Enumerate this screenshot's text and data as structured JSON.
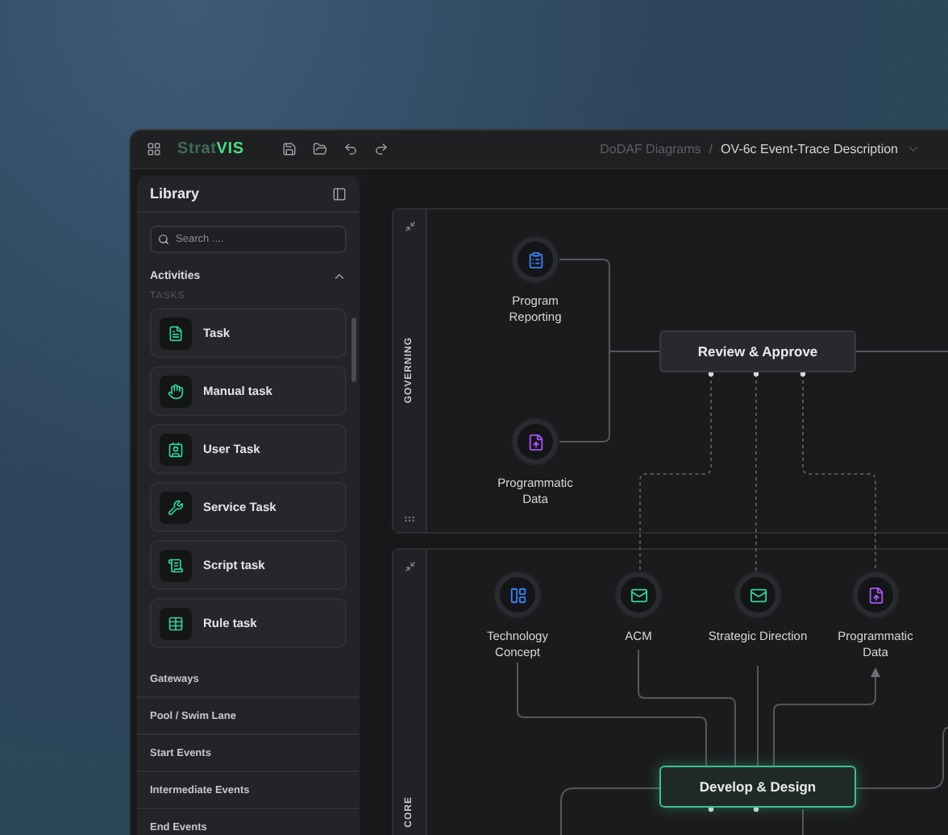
{
  "app": {
    "logo": "Strat**VIS**",
    "breadcrumb": [
      {
        "label": "DoDAF Diagrams",
        "current": false
      },
      {
        "label": "OV-6c Event-Trace Description",
        "current": true
      }
    ],
    "separator": "/"
  },
  "sidebar": {
    "title": "Library",
    "search": {
      "placeholder": "Search ...."
    },
    "section": {
      "title": "Activities",
      "expanded": true,
      "group": "TASKS",
      "items": [
        {
          "label": "Task",
          "kind": "task"
        },
        {
          "label": "Manual task",
          "kind": "manual"
        },
        {
          "label": "User Task",
          "kind": "user"
        },
        {
          "label": "Service Task",
          "kind": "service"
        },
        {
          "label": "Script task",
          "kind": "script"
        },
        {
          "label": "Rule task",
          "kind": "rule"
        }
      ]
    },
    "categories": [
      "Gateways",
      "Pool / Swim Lane",
      "Start Events",
      "Intermediate Events",
      "End Events"
    ]
  },
  "lanes": [
    {
      "label": "GOVERNING",
      "nodes": [
        {
          "kind": "event",
          "label": "Program Reporting",
          "color": "#3b82f6"
        },
        {
          "kind": "event",
          "label": "Programmatic Data",
          "color": "#a855f7"
        },
        {
          "kind": "activity",
          "label": "Review & Approve",
          "highlighted": false
        }
      ]
    },
    {
      "label": "CORE",
      "nodes": [
        {
          "kind": "event",
          "label": "Technology Concept",
          "color": "#3b82f6"
        },
        {
          "kind": "event",
          "label": "ACM",
          "color": "#34d399"
        },
        {
          "kind": "event",
          "label": "Strategic Direction",
          "color": "#34d399"
        },
        {
          "kind": "event",
          "label": "Programmatic Data",
          "color": "#a855f7"
        },
        {
          "kind": "activity",
          "label": "Develop & Design",
          "highlighted": true
        }
      ]
    }
  ]
}
